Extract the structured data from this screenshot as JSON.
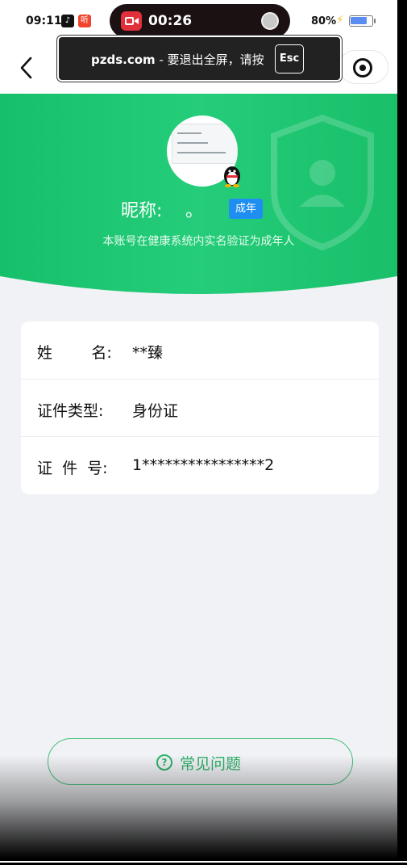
{
  "status_bar": {
    "time": "09:11",
    "app_badges": [
      {
        "icon": "douyin-icon",
        "text": ""
      },
      {
        "icon": "ting-icon",
        "text": "听"
      }
    ],
    "recording": {
      "elapsed": "00:26"
    },
    "battery": {
      "percent_text": "80%",
      "level": 0.8,
      "charging": true
    }
  },
  "fullscreen_toast": {
    "domain": "pzds.com",
    "separator": "-",
    "message": "要退出全屏，请按",
    "key": "Esc"
  },
  "profile": {
    "nickname_label": "昵称:",
    "nickname_value": "。",
    "badge": "成年",
    "description": "本账号在健康系统内实名验证为成年人"
  },
  "identity_rows": [
    {
      "label": "姓        名:",
      "value": "**臻"
    },
    {
      "label": "证件类型:",
      "value": "身份证"
    },
    {
      "label": "证  件  号:",
      "value": "1****************2"
    }
  ],
  "faq": {
    "label": "常见问题",
    "icon": "question-circle-icon"
  },
  "colors": {
    "accent_green": "#1ec56f",
    "badge_blue": "#1f8ef1",
    "page_bg": "#f1f2f6"
  }
}
